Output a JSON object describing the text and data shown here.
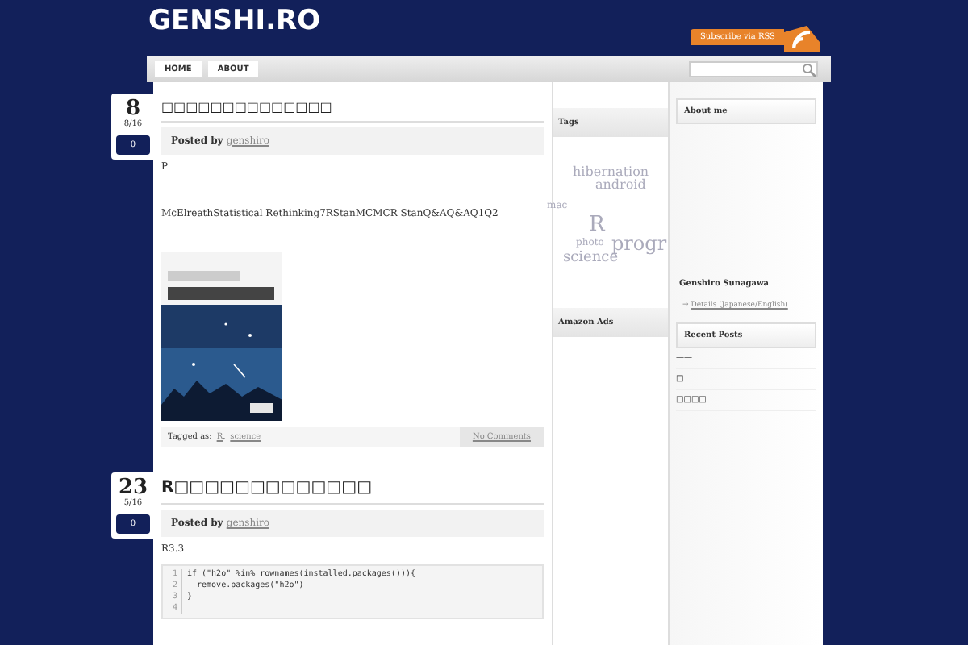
{
  "site": {
    "title": "GENSHI.RO",
    "rss": "Subscribe via RSS"
  },
  "nav": [
    {
      "label": "HOME"
    },
    {
      "label": "ABOUT"
    }
  ],
  "posts": [
    {
      "day": "8",
      "month": "8/16",
      "comments": "0",
      "title": "□□□□□□□□□□□□□□",
      "posted_by": "Posted by",
      "author": "genshiro",
      "paragraphs": [
        "P",
        "McElreathStatistical Rethinking7RStanMCMCR StanQ&AQ&AQ1Q2"
      ],
      "image": {
        "kind": "picture"
      },
      "tagged_label": "Tagged as:",
      "tags": [
        "R",
        "science"
      ],
      "tag_separator": ",",
      "comments_link": "No Comments"
    },
    {
      "day": "23",
      "month": "5/16",
      "comments": "0",
      "title": "R□□□□□□□□□□□□□",
      "posted_by": "Posted by",
      "author": "genshiro",
      "paragraphs": [
        "R3.3"
      ],
      "code": [
        {
          "n": "1",
          "text": "if (\"h2o\" %in% rownames(installed.packages())){"
        },
        {
          "n": "2",
          "text": "  remove.packages(\"h2o\")"
        },
        {
          "n": "3",
          "text": "}"
        },
        {
          "n": "4"
        }
      ]
    }
  ],
  "tags_widget": {
    "title": "Tags",
    "cloud": [
      "hibernation",
      "android",
      "mac",
      "R",
      "photo",
      "science",
      "progr"
    ]
  },
  "ads_widget": {
    "title": "Amazon Ads"
  },
  "about": {
    "title": "About me",
    "name": "Genshiro Sunagawa",
    "link_arrow": "→",
    "link": "Details (Japanese/English)"
  },
  "recent": {
    "title": "Recent Posts",
    "items": [
      "——",
      "□",
      "□□□□"
    ]
  }
}
